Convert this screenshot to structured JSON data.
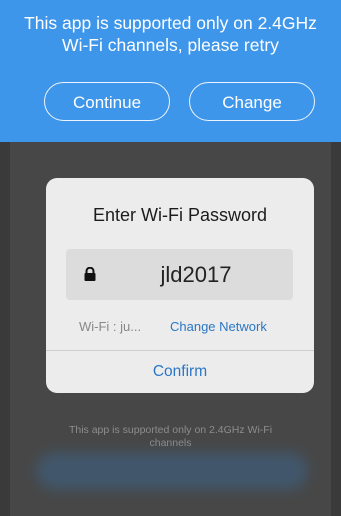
{
  "banner": {
    "message": "This app is supported only on 2.4GHz\nWi-Fi channels, please retry",
    "continue_label": "Continue",
    "change_label": "Change",
    "background_color": "#3d96ea"
  },
  "dialog": {
    "title": "Enter Wi-Fi Password",
    "password_icon": "lock-icon",
    "password_value": "jld2017",
    "wifi_label": "Wi-Fi : ju...",
    "change_network_label": "Change Network",
    "confirm_label": "Confirm",
    "accent_color": "#2a77c6"
  },
  "background": {
    "note": "This app is supported only on 2.4GHz Wi-Fi\nchannels"
  }
}
